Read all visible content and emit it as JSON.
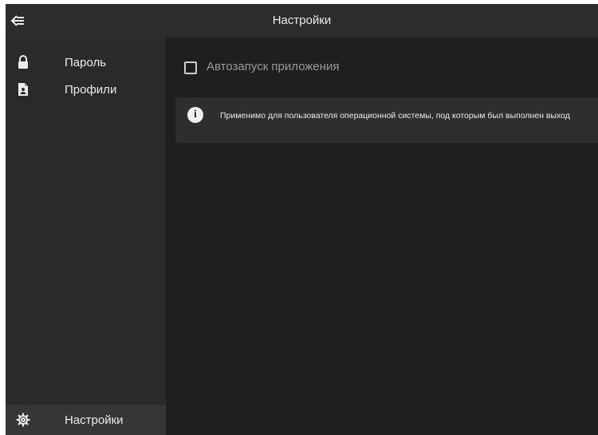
{
  "header": {
    "title": "Настройки",
    "back_icon": "arrow-left-icon"
  },
  "sidebar": {
    "items": [
      {
        "label": "Пароль",
        "icon": "lock-icon"
      },
      {
        "label": "Профили",
        "icon": "file-user-icon"
      }
    ],
    "bottom_item": {
      "label": "Настройки",
      "icon": "gear-icon"
    }
  },
  "main": {
    "autostart": {
      "label": "Автозапуск приложения",
      "checked": false
    },
    "info": {
      "icon": "info-icon",
      "text": "Применимо для пользователя операционной системы, под которым был выполнен выход"
    }
  },
  "colors": {
    "background": "#1f1f1f",
    "topbar": "#2c2c2c",
    "sidebar": "#2a2a2a",
    "sidebar_active": "#363636",
    "info_box": "#2e2e2e",
    "text": "#ececec",
    "muted_text": "#9a9a9a"
  }
}
